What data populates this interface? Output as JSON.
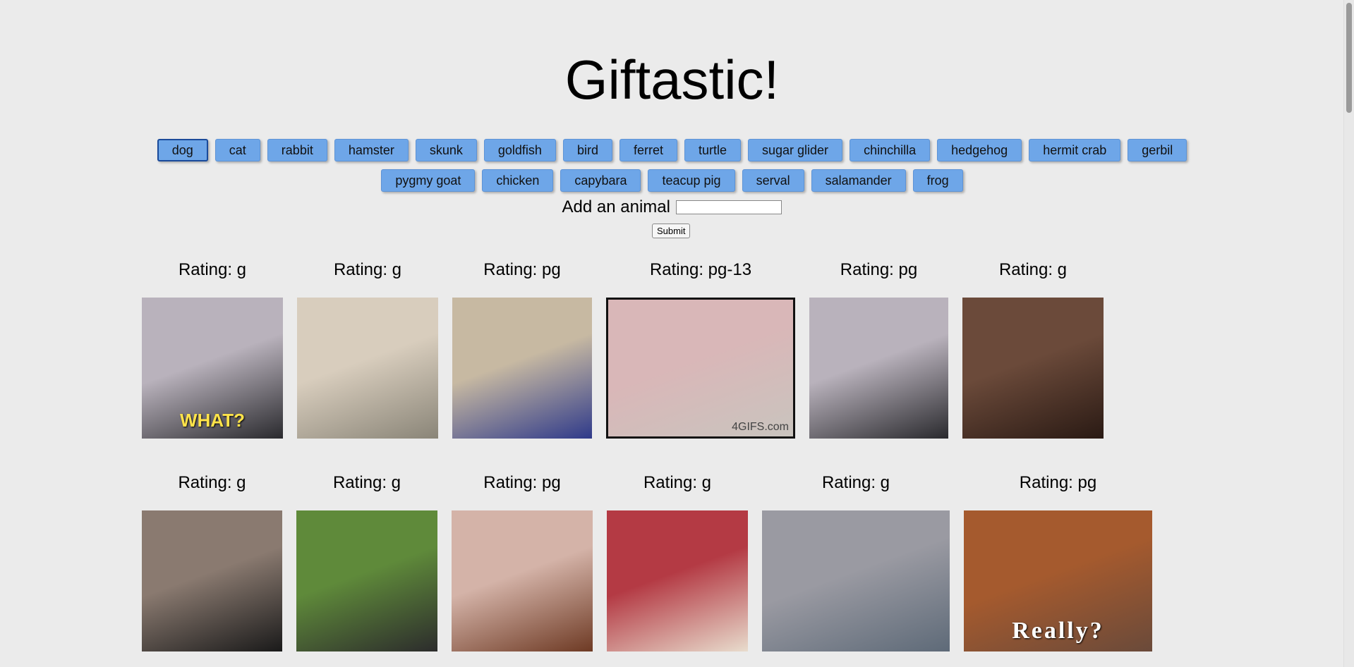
{
  "title": "Giftastic!",
  "buttons_row1": [
    "dog",
    "cat",
    "rabbit",
    "hamster",
    "skunk",
    "goldfish",
    "bird",
    "ferret",
    "turtle",
    "sugar glider",
    "chinchilla",
    "hedgehog",
    "hermit crab",
    "gerbil"
  ],
  "buttons_row2": [
    "pygmy goat",
    "chicken",
    "capybara",
    "teacup pig",
    "serval",
    "salamander",
    "frog"
  ],
  "active_button": "dog",
  "add_form": {
    "label": "Add an animal",
    "input_value": "",
    "submit_label": "Submit"
  },
  "colors": {
    "background": "#ebebeb",
    "button": "#6ea6e8",
    "button_active_border": "#1a4a9a"
  },
  "gifs": [
    {
      "rating_text": "Rating: g",
      "caption": "WHAT?",
      "colors": [
        "#b9b2bc",
        "#2a2a2e"
      ]
    },
    {
      "rating_text": "Rating: g",
      "colors": [
        "#d8cdbd",
        "#8a8578"
      ]
    },
    {
      "rating_text": "Rating: pg",
      "colors": [
        "#c7b9a2",
        "#2f3a8a"
      ]
    },
    {
      "rating_text": "Rating: pg-13",
      "caption": "4GIFS.com",
      "colors": [
        "#d9b7b8",
        "#c9c4be"
      ]
    },
    {
      "rating_text": "Rating: pg",
      "colors": [
        "#b9b2bc",
        "#2a2a2e"
      ]
    },
    {
      "rating_text": "Rating: g",
      "colors": [
        "#6b4a3a",
        "#2a1a14"
      ]
    },
    {
      "rating_text": "Rating: g",
      "colors": [
        "#8a7a70",
        "#1a1a1a"
      ]
    },
    {
      "rating_text": "Rating: g",
      "colors": [
        "#5f8a3a",
        "#2c2c2c"
      ]
    },
    {
      "rating_text": "Rating: pg",
      "colors": [
        "#d4b3a8",
        "#6e3a24"
      ]
    },
    {
      "rating_text": "Rating: g",
      "colors": [
        "#b43a44",
        "#e8dccd"
      ]
    },
    {
      "rating_text": "Rating: g",
      "colors": [
        "#9a9aa2",
        "#5e6a78"
      ]
    },
    {
      "rating_text": "Rating: pg",
      "caption": "Really?",
      "colors": [
        "#a55a2e",
        "#6a4a3a"
      ]
    }
  ]
}
